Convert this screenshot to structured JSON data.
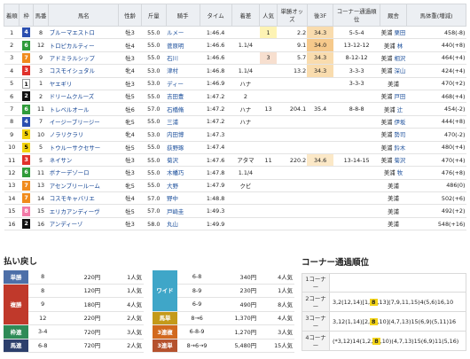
{
  "results": {
    "headers": [
      "着順",
      "枠",
      "馬番",
      "馬名",
      "性齢",
      "斤量",
      "騎手",
      "タイム",
      "着差",
      "人気",
      "単勝オッズ",
      "後3F",
      "コーナー通過順位",
      "厩舎",
      "馬体重(増減)"
    ],
    "rows": [
      {
        "pos": "1",
        "waku": "4",
        "num": "8",
        "horse": "ブルーマエストロ",
        "sexage": "牡3",
        "weight": "55.0",
        "jockey": "ルメー",
        "time": "1:46.4",
        "margin": "",
        "pop": "1",
        "odds": "2.2",
        "agari": "34.3",
        "corner": "5-5-4",
        "stable": "美浦",
        "trainer": "栗田",
        "bw": "458(-8)"
      },
      {
        "pos": "2",
        "waku": "6",
        "num": "12",
        "horse": "トロピカルティー",
        "sexage": "牡4",
        "weight": "55.0",
        "jockey": "菅原明",
        "time": "1:46.6",
        "margin": "1.1/4",
        "pop": "",
        "odds": "9.1",
        "agari": "34.0",
        "corner": "13-12-12",
        "stable": "美浦",
        "trainer": "林",
        "bw": "440(+8)"
      },
      {
        "pos": "3",
        "waku": "7",
        "num": "9",
        "horse": "アドミラルシップ",
        "sexage": "牡3",
        "weight": "55.0",
        "jockey": "石川",
        "time": "1:46.6",
        "margin": "",
        "pop": "3",
        "odds": "5.7",
        "agari": "34.3",
        "corner": "8-12-12",
        "stable": "美浦",
        "trainer": "相沢",
        "bw": "464(+4)"
      },
      {
        "pos": "4",
        "waku": "3",
        "num": "3",
        "horse": "コスモイシュタル",
        "sexage": "牝4",
        "weight": "53.0",
        "jockey": "津村",
        "time": "1:46.8",
        "margin": "1.1/4",
        "pop": "",
        "odds": "13.2",
        "agari": "34.3",
        "corner": "3-3-3",
        "stable": "美浦",
        "trainer": "深山",
        "bw": "424(+4)"
      },
      {
        "pos": "5",
        "waku": "1",
        "num": "1",
        "horse": "ヤエギリ",
        "sexage": "牡3",
        "weight": "53.0",
        "jockey": "ディー",
        "time": "1:46.9",
        "margin": "ハナ",
        "pop": "",
        "odds": "",
        "agari": "",
        "corner": "3-3-3",
        "stable": "美浦",
        "trainer": "",
        "bw": "470(+2)"
      },
      {
        "pos": "6",
        "waku": "2",
        "num": "2",
        "horse": "ドリームクルーズ",
        "sexage": "牡5",
        "weight": "55.0",
        "jockey": "吉田豊",
        "time": "1:47.2",
        "margin": "2",
        "pop": "",
        "odds": "",
        "agari": "",
        "corner": "",
        "stable": "美浦",
        "trainer": "戸田",
        "bw": "468(+4)"
      },
      {
        "pos": "7",
        "waku": "6",
        "num": "11",
        "horse": "トレベルオール",
        "sexage": "牡6",
        "weight": "57.0",
        "jockey": "石橋脩",
        "time": "1:47.2",
        "margin": "ハナ",
        "pop": "13",
        "odds": "204.1",
        "agari": "35.4",
        "corner": "8-8-8",
        "stable": "美浦",
        "trainer": "辻",
        "bw": "454(-2)"
      },
      {
        "pos": "8",
        "waku": "4",
        "num": "7",
        "horse": "イージーブリージー",
        "sexage": "牝5",
        "weight": "55.0",
        "jockey": "三浦",
        "time": "1:47.2",
        "margin": "ハナ",
        "pop": "",
        "odds": "",
        "agari": "",
        "corner": "",
        "stable": "美浦",
        "trainer": "伊坂",
        "bw": "444(+8)"
      },
      {
        "pos": "9",
        "waku": "5",
        "num": "10",
        "horse": "ノラリクラリ",
        "sexage": "牝4",
        "weight": "53.0",
        "jockey": "内田博",
        "time": "1:47.3",
        "margin": "",
        "pop": "",
        "odds": "",
        "agari": "",
        "corner": "",
        "stable": "美浦",
        "trainer": "勢司",
        "bw": "470(-2)"
      },
      {
        "pos": "10",
        "waku": "5",
        "num": "5",
        "horse": "トウルーサクセサー",
        "sexage": "牡5",
        "weight": "55.0",
        "jockey": "荻野琢",
        "time": "1:47.4",
        "margin": "",
        "pop": "",
        "odds": "",
        "agari": "",
        "corner": "",
        "stable": "美浦",
        "trainer": "鈴木",
        "bw": "480(+4)"
      },
      {
        "pos": "11",
        "waku": "3",
        "num": "5",
        "horse": "ネイサン",
        "sexage": "牡3",
        "weight": "55.0",
        "jockey": "菊沢",
        "time": "1:47.6",
        "margin": "アタマ",
        "pop": "11",
        "odds": "220.2",
        "agari": "34.6",
        "corner": "13-14-15",
        "stable": "美浦",
        "trainer": "菊沢",
        "bw": "470(+4)"
      },
      {
        "pos": "12",
        "waku": "6",
        "num": "11",
        "horse": "ボナーデゾーロ",
        "sexage": "牡3",
        "weight": "55.0",
        "jockey": "木幡巧",
        "time": "1:47.8",
        "margin": "1.1/4",
        "pop": "",
        "odds": "",
        "agari": "",
        "corner": "",
        "stable": "美浦",
        "trainer": "牧",
        "bw": "476(+8)"
      },
      {
        "pos": "13",
        "waku": "7",
        "num": "13",
        "horse": "アセンブリールーム",
        "sexage": "牝5",
        "weight": "55.0",
        "jockey": "大野",
        "time": "1:47.9",
        "margin": "クビ",
        "pop": "",
        "odds": "",
        "agari": "",
        "corner": "",
        "stable": "美浦",
        "trainer": "",
        "bw": "486(0)"
      },
      {
        "pos": "14",
        "waku": "7",
        "num": "14",
        "horse": "コスモキャバリエ",
        "sexage": "牡4",
        "weight": "57.0",
        "jockey": "野中",
        "time": "1:48.8",
        "margin": "",
        "pop": "",
        "odds": "",
        "agari": "",
        "corner": "",
        "stable": "美浦",
        "trainer": "",
        "bw": "502(+6)"
      },
      {
        "pos": "15",
        "waku": "8",
        "num": "15",
        "horse": "エリカアンディーヴ",
        "sexage": "牡5",
        "weight": "57.0",
        "jockey": "戸崎圭",
        "time": "1:49.3",
        "margin": "",
        "pop": "",
        "odds": "",
        "agari": "",
        "corner": "",
        "stable": "美浦",
        "trainer": "",
        "bw": "492(+2)"
      },
      {
        "pos": "16",
        "waku": "2",
        "num": "16",
        "horse": "アンディーゾ",
        "sexage": "牡3",
        "weight": "58.0",
        "jockey": "丸山",
        "time": "1:49.9",
        "margin": "",
        "pop": "",
        "odds": "",
        "agari": "",
        "corner": "",
        "stable": "美浦",
        "trainer": "",
        "bw": "548(+16)"
      }
    ]
  },
  "payout": {
    "title": "払い戻し",
    "left": [
      {
        "type": "単勝",
        "t": "t-tan",
        "nums": [
          "8"
        ],
        "pays": [
          "220円"
        ],
        "pops": [
          "1人気"
        ]
      },
      {
        "type": "複勝",
        "t": "t-fuku",
        "nums": [
          "8",
          "9",
          "12"
        ],
        "pays": [
          "120円",
          "180円",
          "220円"
        ],
        "pops": [
          "1人気",
          "4人気",
          "2人気"
        ]
      },
      {
        "type": "枠連",
        "t": "t-waku",
        "nums": [
          "3-4"
        ],
        "pays": [
          "720円"
        ],
        "pops": [
          "3人気"
        ]
      },
      {
        "type": "馬連",
        "t": "t-uren",
        "nums": [
          "6-8"
        ],
        "pays": [
          "720円"
        ],
        "pops": [
          "2人気"
        ]
      }
    ],
    "right": [
      {
        "type": "ワイド",
        "t": "t-wide",
        "nums": [
          "6-8",
          "8-9",
          "6-9"
        ],
        "pays": [
          "340円",
          "230円",
          "490円"
        ],
        "pops": [
          "4人気",
          "1人気",
          "8人気"
        ]
      },
      {
        "type": "馬単",
        "t": "t-utan",
        "nums": [
          "8→6"
        ],
        "pays": [
          "1,370円"
        ],
        "pops": [
          "4人気"
        ]
      },
      {
        "type": "3連複",
        "t": "t-3fuku",
        "nums": [
          "6-8-9"
        ],
        "pays": [
          "1,270円"
        ],
        "pops": [
          "3人気"
        ]
      },
      {
        "type": "3連単",
        "t": "t-3tan",
        "nums": [
          "8→6→9"
        ],
        "pays": [
          "5,480円"
        ],
        "pops": [
          "15人気"
        ]
      }
    ]
  },
  "corner": {
    "title": "コーナー通過順位",
    "rows": [
      {
        "label": "1コーナー",
        "pre": "",
        "mark": "",
        "post": ""
      },
      {
        "label": "2コーナー",
        "pre": "3,2(12,14)[1,",
        "mark": "8",
        "post": ",13](7,9,11,15)4(5,6)16,10"
      },
      {
        "label": "3コーナー",
        "pre": "3,12(1,14)[2,",
        "mark": "8",
        "post": ",10](4,7,13)15(6,9)(5,11)16"
      },
      {
        "label": "4コーナー",
        "pre": "(*3,12)14(1,2,",
        "mark": "8",
        "post": ",10)(4,7,13)15(6,9)11(5,16)"
      }
    ]
  }
}
